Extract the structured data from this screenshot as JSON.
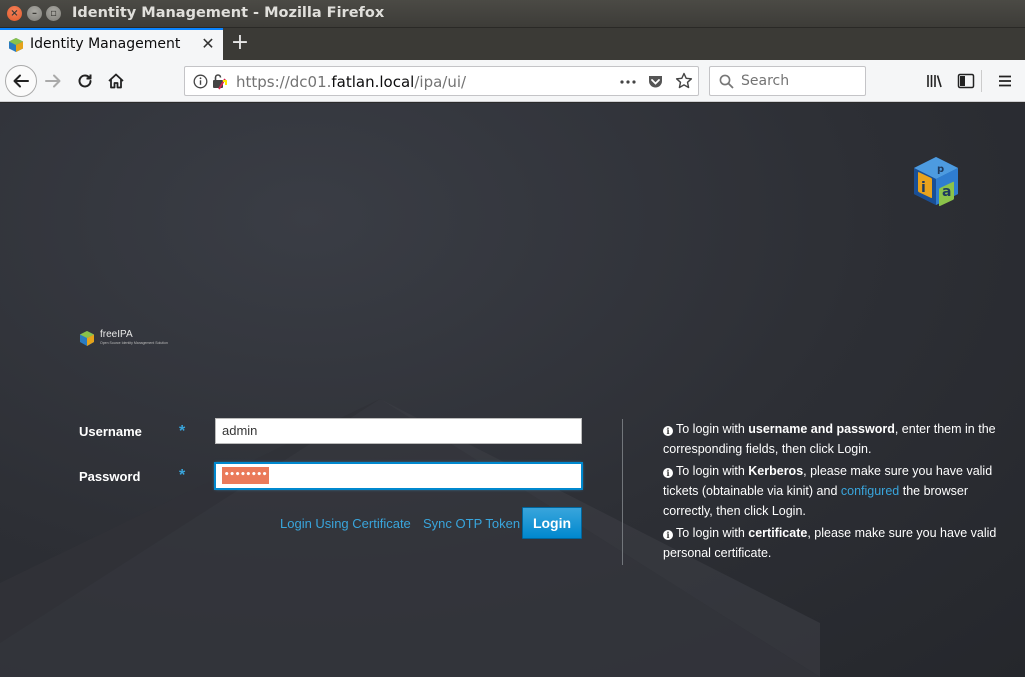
{
  "window": {
    "title": "Identity Management - Mozilla Firefox"
  },
  "tab": {
    "label": "Identity Management",
    "close": "✕",
    "new_tab": "+"
  },
  "navbar": {
    "url_prefix": "https://dc01.",
    "url_host": "fatlan.local",
    "url_path": "/ipa/ui/",
    "search_placeholder": "Search"
  },
  "brand": {
    "name": "freeIPA",
    "tagline": "Open Source Identity Management Solution"
  },
  "form": {
    "username_label": "Username",
    "password_label": "Password",
    "required_marker": "*",
    "username_value": "admin",
    "password_mask": "••••••••",
    "login_cert_link": "Login Using Certificate",
    "sync_otp_link": "Sync OTP Token",
    "login_button": "Login"
  },
  "help": {
    "info_glyph": "i",
    "item1": {
      "pre": "To login with ",
      "bold": "username and password",
      "post": ", enter them in the corresponding fields, then click Login."
    },
    "item2": {
      "pre": "To login with ",
      "bold": "Kerberos",
      "mid": ", please make sure you have valid tickets (obtainable via kinit) and ",
      "link": "configured",
      "post": " the browser correctly, then click Login."
    },
    "item3": {
      "pre": "To login with ",
      "bold": "certificate",
      "post": ", please make sure you have valid personal certificate."
    }
  },
  "colors": {
    "accent": "#0088ce",
    "link": "#39a5dc",
    "background": "#2d2f35",
    "firefox_blue": "#0a84ff"
  }
}
